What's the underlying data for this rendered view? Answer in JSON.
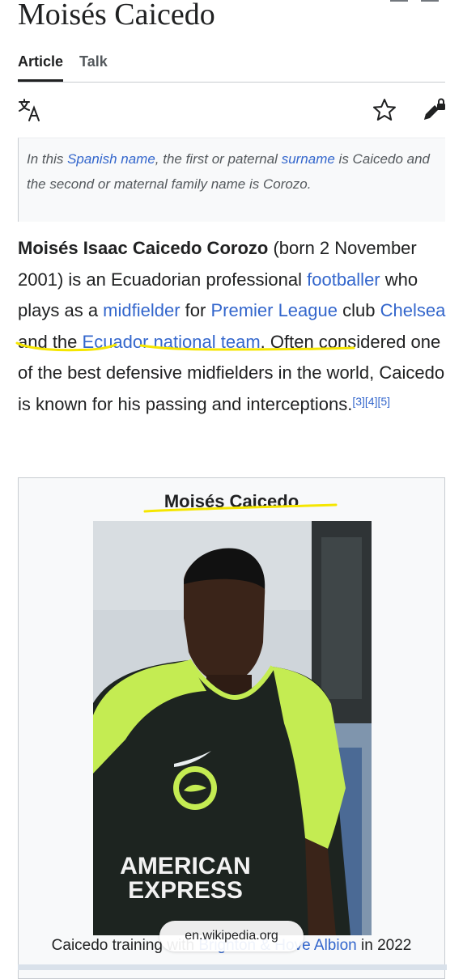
{
  "article": {
    "title": "Moisés Caicedo",
    "tabs": [
      "Article",
      "Talk"
    ]
  },
  "toolbar": {
    "icons": [
      "language-icon",
      "star-icon",
      "edit-lock-icon"
    ]
  },
  "hatnote": {
    "p1": "In this ",
    "link1": "Spanish name",
    "p2": ", the first or paternal ",
    "link2": "surname",
    "p3": " is Caicedo and the second or maternal family name is Corozo."
  },
  "lead": {
    "bold_name": "Moisés Isaac Caicedo Corozo",
    "t1": " (born 2 November 2001) is an Ecuadorian professional ",
    "link_footballer": "footballer",
    "t2": " who plays as a ",
    "link_midfielder": "midfielder",
    "t3": " for ",
    "link_league": "Premier League",
    "t4": " club ",
    "link_club": "Chelsea",
    "t5": " and the ",
    "link_national": "Ecuador national team",
    "t6": ". Often considered one of the best defensive midfielders in the world, Caicedo is known for his passing and interceptions.",
    "refs": [
      "[3]",
      "[4]",
      "[5]"
    ]
  },
  "infobox": {
    "title": "Moisés Caicedo",
    "caption_pre": "Caicedo training with ",
    "caption_link": "Brighton & Hove Albion",
    "caption_post": " in 2022",
    "shirt_line1": "AMERICAN",
    "shirt_line2": "EXPRESS"
  },
  "browser": {
    "url": "en.wikipedia.org"
  },
  "colors": {
    "link": "#3366cc",
    "text": "#202122",
    "highlight": "#f5e600",
    "shirt_green": "#c4ec52",
    "shirt_dark": "#1d2420"
  }
}
